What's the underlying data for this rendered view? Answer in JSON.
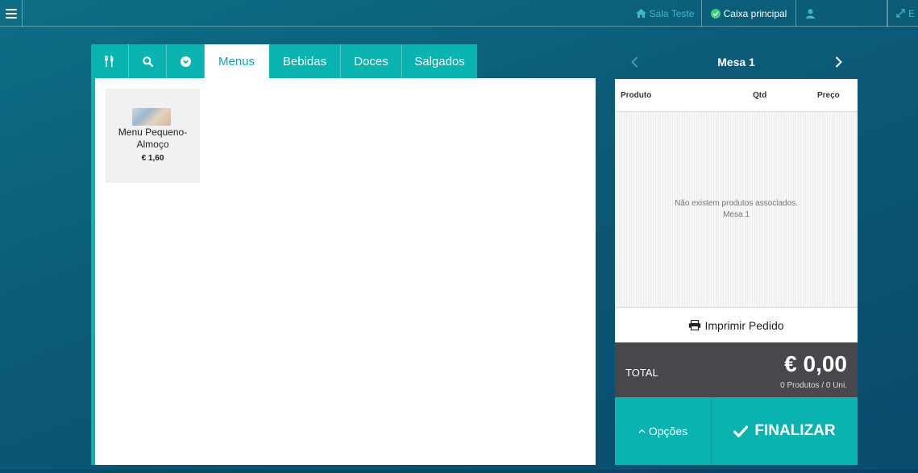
{
  "topbar": {
    "menu_icon": "hamburger-icon",
    "sala": {
      "icon": "home-icon",
      "label": "Sala Teste"
    },
    "caixa": {
      "icon": "check-circle-icon",
      "label": "Caixa principal"
    },
    "user": {
      "icon": "user-icon",
      "label": ""
    },
    "expand": {
      "icon": "expand-icon",
      "label": "E"
    }
  },
  "product_tabs": {
    "icon_tabs": [
      "cutlery-icon",
      "search-icon",
      "chevron-circle-down-icon"
    ],
    "tabs": [
      {
        "label": "Menus",
        "active": true
      },
      {
        "label": "Bebidas",
        "active": false
      },
      {
        "label": "Doces",
        "active": false
      },
      {
        "label": "Salgados",
        "active": false
      }
    ]
  },
  "products": [
    {
      "name": "Menu Pequeno-Almoço",
      "price": "€ 1,60"
    }
  ],
  "order": {
    "title": "Mesa 1",
    "columns": {
      "produto": "Produto",
      "qtd": "Qtd",
      "preco": "Preço"
    },
    "empty_message": "Não existem produtos associados.",
    "empty_table": "Mesa 1",
    "print_label": "Imprimir Pedido"
  },
  "totals": {
    "label": "TOTAL",
    "value": "€ 0,00",
    "summary": "0 Produtos / 0 Uni."
  },
  "actions": {
    "opcoes_label": "Opções",
    "finalizar_label": "FINALIZAR"
  },
  "colors": {
    "accent": "#08b3b0",
    "total_bg": "#4a474c",
    "background": "#0b5b78"
  }
}
